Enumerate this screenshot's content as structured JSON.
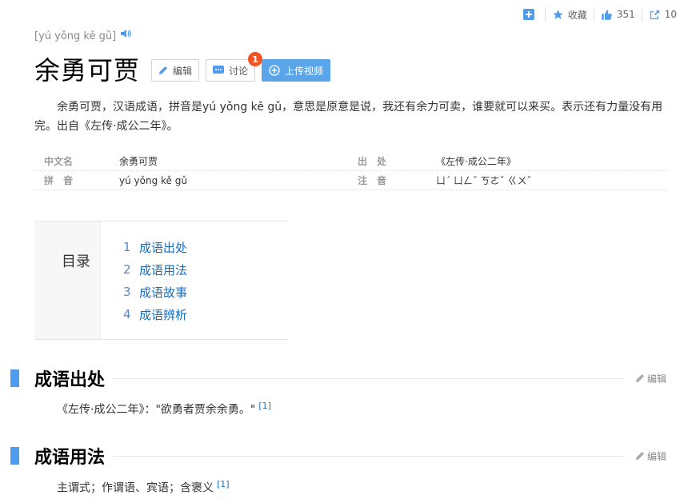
{
  "topbar": {
    "collect_label": "收藏",
    "like_count": "351",
    "share_count": "10"
  },
  "header": {
    "pinyin": "[yú yǒng kě gǔ]",
    "title": "余勇可贾",
    "edit_label": "编辑",
    "discuss_label": "讨论",
    "discuss_badge": "1",
    "upload_label": "上传视频"
  },
  "summary": "余勇可贾，汉语成语，拼音是yú yǒng kě gǔ，意思是原意是说，我还有余力可卖，谁要就可以来买。表示还有力量没有用完。出自《左传·成公二年》。",
  "basic_info": [
    {
      "name": "中文名",
      "value": "余勇可贾",
      "name2": "出　处",
      "value2": "《左传·成公二年》"
    },
    {
      "name": "拼　音",
      "value": "yú yǒng kě gǔ",
      "name2": "注　音",
      "value2": "ㄩˊ ㄩㄥˇ ㄎㄜˇ ㄍㄨˇ"
    }
  ],
  "catalog": {
    "title": "目录",
    "items": [
      {
        "num": "1",
        "label": "成语出处"
      },
      {
        "num": "2",
        "label": "成语用法"
      },
      {
        "num": "3",
        "label": "成语故事"
      },
      {
        "num": "4",
        "label": "成语辨析"
      }
    ]
  },
  "sections": [
    {
      "title": "成语出处",
      "edit_label": "编辑",
      "text": "《左传·成公二年》：\"欲勇者贾余余勇。\"",
      "ref": "[1]"
    },
    {
      "title": "成语用法",
      "edit_label": "编辑",
      "text": "主谓式；作谓语、宾语；含褒义",
      "ref": "[1]"
    }
  ],
  "colors": {
    "accent": "#4f9cee",
    "link": "#136ec2",
    "badge": "#f25224",
    "upload_button": "#5aa5ea"
  }
}
